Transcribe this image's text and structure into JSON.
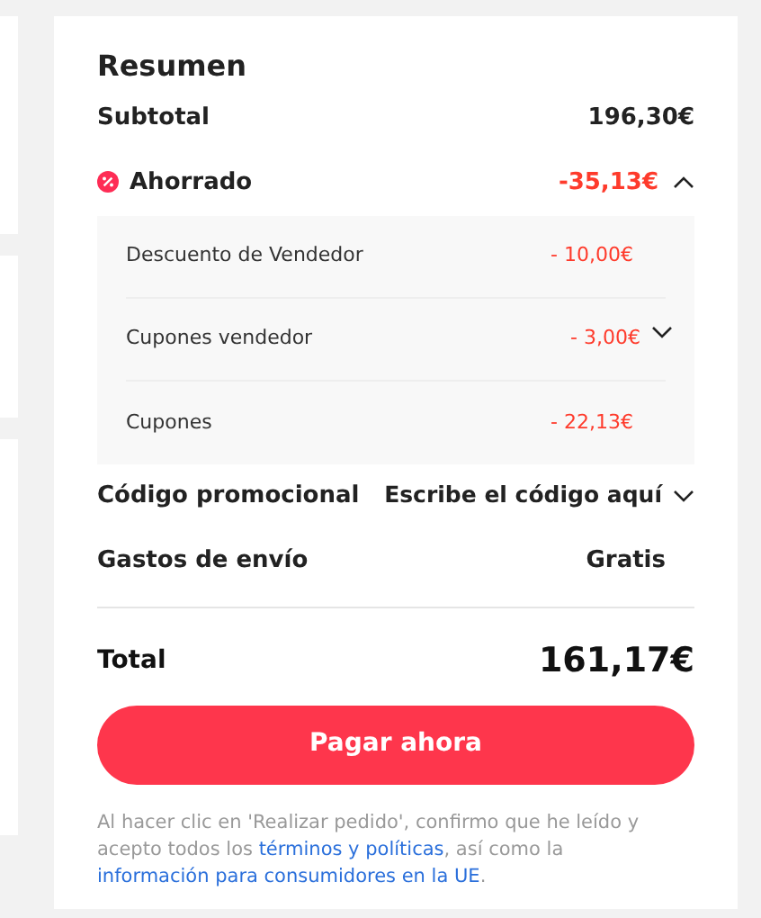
{
  "summary": {
    "title": "Resumen",
    "subtotal": {
      "label": "Subtotal",
      "value": "196,30€"
    },
    "savings": {
      "label": "Ahorrado",
      "value": "-35,13€",
      "expanded": true,
      "items": [
        {
          "label": "Descuento de Vendedor",
          "value": "- 10,00€"
        },
        {
          "label": "Cupones vendedor",
          "value": "- 3,00€",
          "expanded": false
        },
        {
          "label": "Cupones",
          "value": "- 22,13€"
        }
      ]
    },
    "promo": {
      "label": "Código promocional",
      "placeholder": "Escribe el código aquí",
      "expanded": false
    },
    "shipping": {
      "label": "Gastos de envío",
      "value": "Gratis"
    },
    "total": {
      "label": "Total",
      "value": "161,17€"
    },
    "pay_button": "Pagar ahora",
    "legal": [
      {
        "kind": "text",
        "text": "Al hacer clic en 'Realizar pedido', confirmo que he leído y acepto todos los "
      },
      {
        "kind": "link",
        "text": "términos y políticas"
      },
      {
        "kind": "text",
        "text": ", así como la "
      },
      {
        "kind": "link",
        "text": "información para consumidores en la UE"
      },
      {
        "kind": "text",
        "text": "."
      }
    ]
  }
}
